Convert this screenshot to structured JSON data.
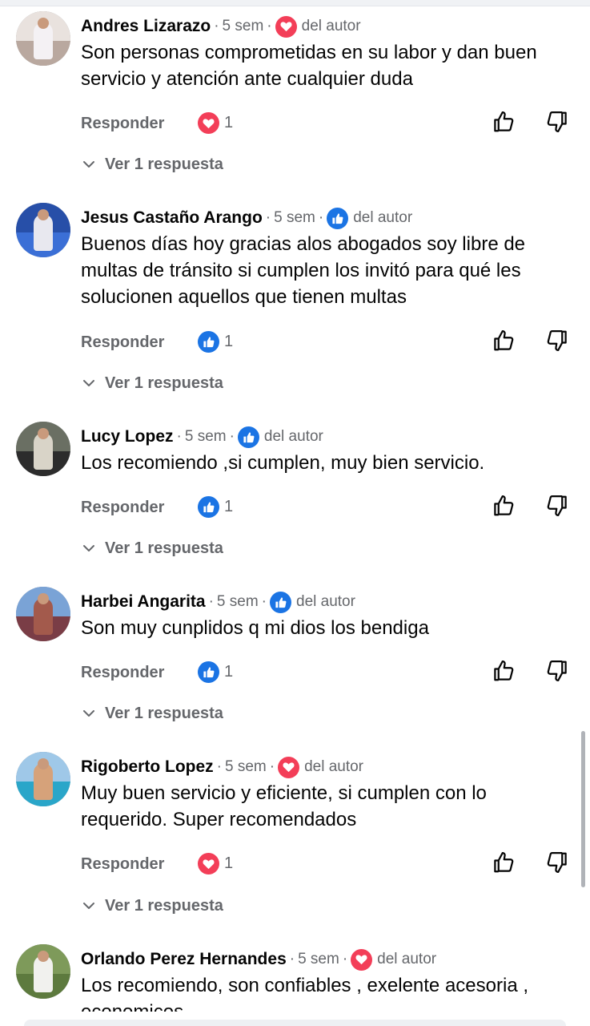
{
  "colors": {
    "heart": "#f33e58",
    "like": "#1b74e4",
    "secondary": "#65676b"
  },
  "comments": [
    {
      "author": "Andres Lizarazo",
      "time": "5 sem",
      "author_reaction": "heart-icon",
      "author_tag": "del autor",
      "text": "Son personas comprometidas en su labor y dan buen servicio y atención ante cualquier duda",
      "reply_label": "Responder",
      "reaction_icon": "heart-icon",
      "reaction_count": "1",
      "more_replies": "Ver 1 respuesta"
    },
    {
      "author": "Jesus Castaño Arango",
      "time": "5 sem",
      "author_reaction": "like-icon",
      "author_tag": "del autor",
      "text": "Buenos días hoy gracias alos abogados soy libre de multas de tránsito si cumplen los invitó para qué les solucionen  aquellos que tienen multas",
      "reply_label": "Responder",
      "reaction_icon": "like-icon",
      "reaction_count": "1",
      "more_replies": "Ver 1 respuesta"
    },
    {
      "author": "Lucy Lopez",
      "time": "5 sem",
      "author_reaction": "like-icon",
      "author_tag": "del autor",
      "text": "Los recomiendo ,si cumplen, muy bien servicio.",
      "reply_label": "Responder",
      "reaction_icon": "like-icon",
      "reaction_count": "1",
      "more_replies": "Ver 1 respuesta"
    },
    {
      "author": "Harbei Angarita",
      "time": "5 sem",
      "author_reaction": "like-icon",
      "author_tag": "del autor",
      "text": "Son muy cunplidos q mi dios los bendiga",
      "reply_label": "Responder",
      "reaction_icon": "like-icon",
      "reaction_count": "1",
      "more_replies": "Ver 1 respuesta"
    },
    {
      "author": "Rigoberto Lopez",
      "time": "5 sem",
      "author_reaction": "heart-icon",
      "author_tag": "del autor",
      "text": "Muy buen servicio y eficiente, si cumplen con lo requerido. Super recomendados",
      "reply_label": "Responder",
      "reaction_icon": "heart-icon",
      "reaction_count": "1",
      "more_replies": "Ver 1 respuesta"
    },
    {
      "author": "Orlando Perez Hernandes",
      "time": "5 sem",
      "author_reaction": "heart-icon",
      "author_tag": "del autor",
      "text": "Los recomiendo, son confiables , exelente acesoria , economicos"
    }
  ]
}
